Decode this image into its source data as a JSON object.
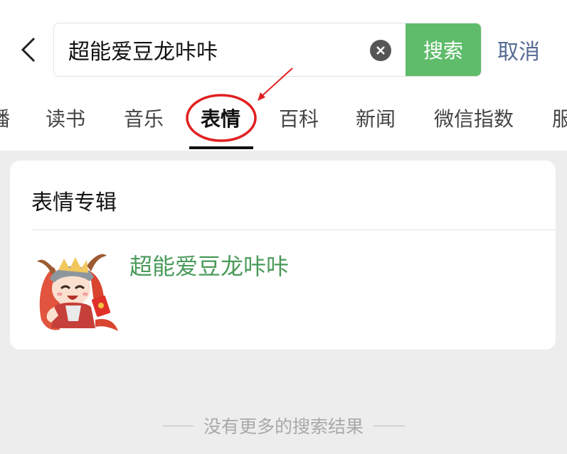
{
  "search": {
    "query": "超能爱豆龙咔咔",
    "submit_label": "搜索",
    "cancel_label": "取消"
  },
  "tabs": [
    {
      "label": "播"
    },
    {
      "label": "读书"
    },
    {
      "label": "音乐"
    },
    {
      "label": "表情"
    },
    {
      "label": "百科"
    },
    {
      "label": "新闻"
    },
    {
      "label": "微信指数"
    },
    {
      "label": "服"
    }
  ],
  "active_tab": "表情",
  "result_card": {
    "title": "表情专辑",
    "item_name": "超能爱豆龙咔咔"
  },
  "footer": {
    "text": "没有更多的搜索结果"
  },
  "colors": {
    "accent_green": "#5fbc6a",
    "link_blue": "#576b95",
    "annotation_red": "#e02020"
  }
}
